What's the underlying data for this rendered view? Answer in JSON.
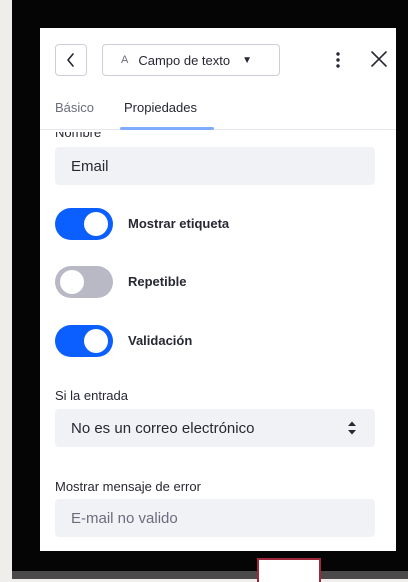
{
  "header": {
    "back_icon": "chevron-left-icon",
    "field_type": {
      "glyph": "A",
      "label": "Campo de texto",
      "caret_icon": "caret-down-icon"
    },
    "more_icon": "ellipsis-vertical-icon",
    "close_icon": "close-icon"
  },
  "tabs": [
    {
      "label": "Básico",
      "active": false
    },
    {
      "label": "Propiedades",
      "active": true
    }
  ],
  "form": {
    "name_label": "Nombre",
    "name_value": "Email",
    "toggles": [
      {
        "label": "Mostrar etiqueta",
        "on": true
      },
      {
        "label": "Repetible",
        "on": false
      },
      {
        "label": "Validación",
        "on": true
      }
    ],
    "validation": {
      "condition_label": "Si la entrada",
      "condition_value": "No es un correo electrónico",
      "error_label": "Mostrar mensaje de error",
      "error_value": "E-mail no valido"
    }
  },
  "colors": {
    "accent": "#0b5fff",
    "toggle_off": "#b8b9c4",
    "tab_indicator": "#80acff",
    "input_bg": "#f1f2f5",
    "text": "#272833",
    "muted": "#6b6c7e",
    "frame": "#050505"
  }
}
